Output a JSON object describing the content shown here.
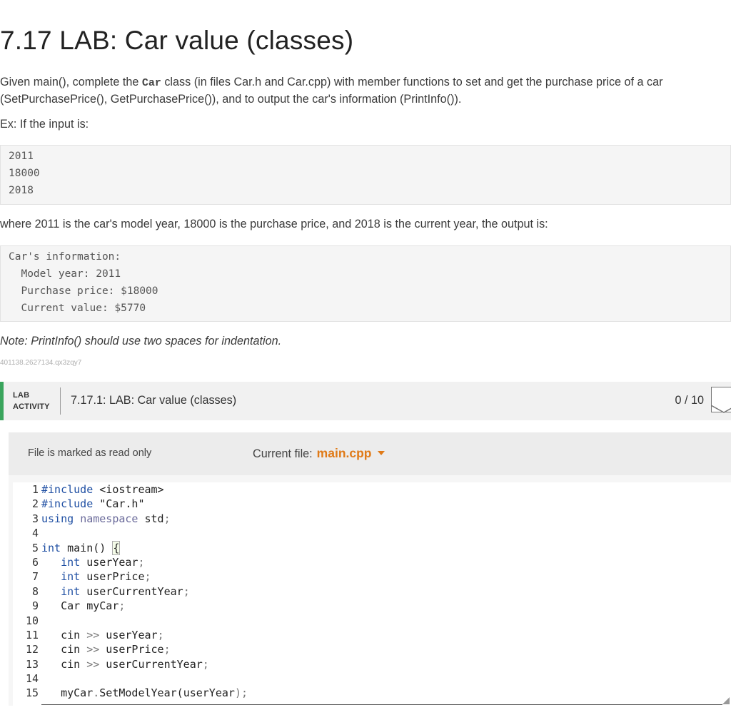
{
  "title": "7.17 LAB: Car value (classes)",
  "intro": {
    "before": "Given main(), complete the ",
    "code": "Car",
    "after": " class (in files Car.h and Car.cpp) with member functions to set and get the purchase price of a car (SetPurchasePrice(), GetPurchasePrice()), and to output the car's information (PrintInfo())."
  },
  "example_label": "Ex: If the input is:",
  "input_lines": [
    "2011",
    "18000",
    "2018"
  ],
  "where_text": "where 2011 is the car's model year, 18000 is the purchase price, and 2018 is the current year, the output is:",
  "output_lines": [
    "Car's information:",
    "  Model year: 2011",
    "  Purchase price: $18000",
    "  Current value: $5770"
  ],
  "note": "Note: PrintInfo() should use two spaces for indentation.",
  "content_id": "401138.2627134.qx3zqy7",
  "lab": {
    "tag_line1": "LAB",
    "tag_line2": "ACTIVITY",
    "title": "7.17.1: LAB: Car value (classes)",
    "score": "0 / 10",
    "accent": "#3aa55d"
  },
  "file_bar": {
    "readonly_text": "File is marked as read only",
    "current_label": "Current file:",
    "current_file": "main.cpp",
    "accent": "#e07a17"
  },
  "code_lines": [
    "#include <iostream>",
    "#include \"Car.h\"",
    "using namespace std;",
    "",
    "int main() {",
    "   int userYear;",
    "   int userPrice;",
    "   int userCurrentYear;",
    "   Car myCar;",
    "",
    "   cin >> userYear;",
    "   cin >> userPrice;",
    "   cin >> userCurrentYear;",
    "",
    "   myCar.SetModelYear(userYear);"
  ]
}
